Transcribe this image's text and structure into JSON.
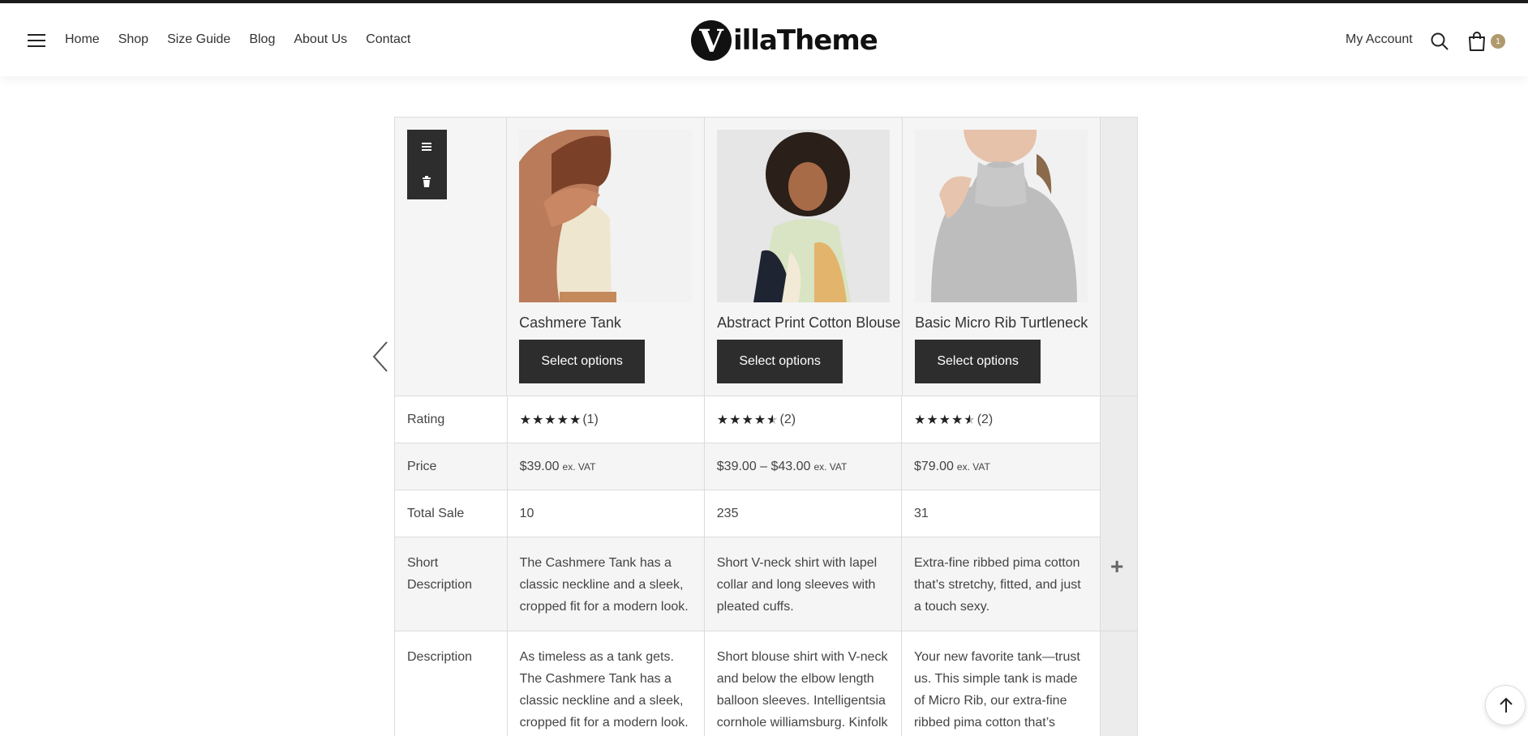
{
  "header": {
    "nav": [
      "Home",
      "Shop",
      "Size Guide",
      "Blog",
      "About Us",
      "Contact"
    ],
    "logo_letter": "V",
    "logo_text": "illaTheme",
    "my_account": "My Account",
    "cart_count": "1",
    "brand_badge_color": "#b09a6d"
  },
  "compare": {
    "labels": {
      "rating": "Rating",
      "price": "Price",
      "total_sale": "Total Sale",
      "short_description": "Short Description",
      "description": "Description"
    },
    "select_label": "Select options",
    "products": [
      {
        "name": "Cashmere Tank",
        "rating": 5,
        "rating_count": "(1)",
        "price": "$39.00",
        "vat": "ex. VAT",
        "total_sale": "10",
        "short_description": "The Cashmere Tank has a classic neckline and a sleek, cropped fit for a modern look.",
        "description": "As timeless as a tank gets. The Cashmere Tank has a classic neckline and a sleek, cropped fit for a modern look. Wear it"
      },
      {
        "name": "Abstract Print Cotton Blouse",
        "rating": 4.5,
        "rating_count": "(2)",
        "price": "$39.00 – $43.00",
        "vat": "ex. VAT",
        "total_sale": "235",
        "short_description": "Short V-neck shirt with lapel collar and long sleeves with pleated cuffs.",
        "description": "Short blouse shirt with V-neck and below the elbow length balloon sleeves. Intelligentsia cornhole williamsburg. Kinfolk"
      },
      {
        "name": "Basic Micro Rib Turtleneck",
        "rating": 4.5,
        "rating_count": "(2)",
        "price": "$79.00",
        "vat": "ex. VAT",
        "total_sale": "31",
        "short_description": "Extra-fine ribbed pima cotton that’s stretchy, fitted, and just a touch sexy.",
        "description": "Your new favorite tank—trust us. This simple tank is made of Micro Rib, our extra-fine ribbed pima cotton that’s stretchy,"
      }
    ]
  }
}
